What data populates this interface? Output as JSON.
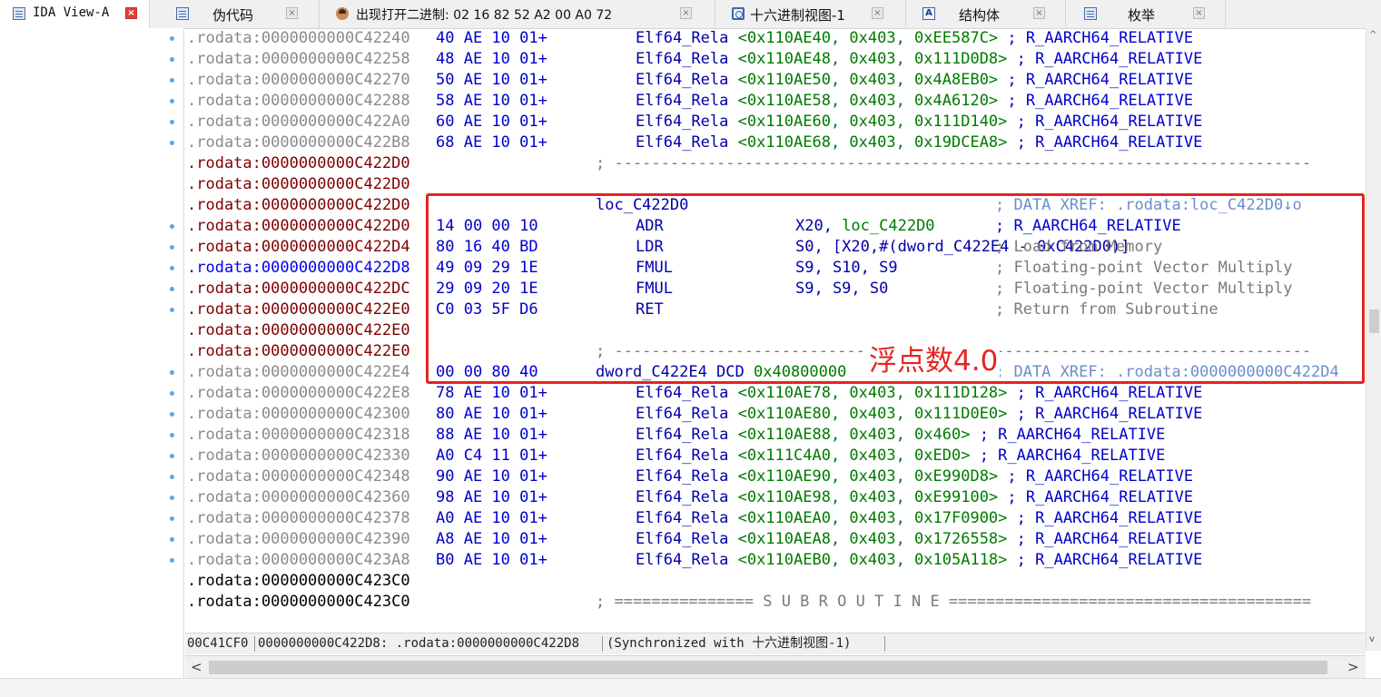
{
  "tabs": [
    {
      "label": "IDA View-A",
      "icon": "doc-icon",
      "active": true
    },
    {
      "label": "伪代码",
      "icon": "doc-icon",
      "active": false
    },
    {
      "label": "出现打开二进制: 02 16 82 52 A2 00 A0 72",
      "icon": "user-icon",
      "active": false
    },
    {
      "label": "十六进制视图-1",
      "icon": "hex-icon",
      "active": false
    },
    {
      "label": "结构体",
      "icon": "struct-icon",
      "active": false
    },
    {
      "label": "枚举",
      "icon": "doc-icon",
      "active": false
    }
  ],
  "close_glyph": "×",
  "listing": [
    {
      "addr": ".rodata:0000000000C42240",
      "addr_color": "gray",
      "bytes": "40 AE 10 01+",
      "code": "Elf64_Rela <0x110AE40, 0x403, 0xEE587C> ; R_AARCH64_RELATIVE",
      "dot": true
    },
    {
      "addr": ".rodata:0000000000C42258",
      "addr_color": "gray",
      "bytes": "48 AE 10 01+",
      "code": "Elf64_Rela <0x110AE48, 0x403, 0x111D0D8> ; R_AARCH64_RELATIVE",
      "dot": true
    },
    {
      "addr": ".rodata:0000000000C42270",
      "addr_color": "gray",
      "bytes": "50 AE 10 01+",
      "code": "Elf64_Rela <0x110AE50, 0x403, 0x4A8EB0> ; R_AARCH64_RELATIVE",
      "dot": true
    },
    {
      "addr": ".rodata:0000000000C42288",
      "addr_color": "gray",
      "bytes": "58 AE 10 01+",
      "code": "Elf64_Rela <0x110AE58, 0x403, 0x4A6120> ; R_AARCH64_RELATIVE",
      "dot": true
    },
    {
      "addr": ".rodata:0000000000C422A0",
      "addr_color": "gray",
      "bytes": "60 AE 10 01+",
      "code": "Elf64_Rela <0x110AE60, 0x403, 0x111D140> ; R_AARCH64_RELATIVE",
      "dot": true
    },
    {
      "addr": ".rodata:0000000000C422B8",
      "addr_color": "gray",
      "bytes": "68 AE 10 01+",
      "code": "Elf64_Rela <0x110AE68, 0x403, 0x19DCEA8> ; R_AARCH64_RELATIVE",
      "dot": true
    },
    {
      "addr": ".rodata:0000000000C422D0",
      "addr_color": "red",
      "bytes": "",
      "code": "; ---------------------------------------------------------------------------",
      "dot": false
    },
    {
      "addr": ".rodata:0000000000C422D0",
      "addr_color": "red",
      "bytes": "",
      "code": "",
      "dot": false
    },
    {
      "addr": ".rodata:0000000000C422D0",
      "addr_color": "red",
      "bytes": "",
      "code": "loc_C422D0",
      "comment": "; DATA XREF: .rodata:loc_C422D0↓o",
      "dot": false
    },
    {
      "addr": ".rodata:0000000000C422D0",
      "addr_color": "red",
      "bytes": "14 00 00 10",
      "mnem": "ADR",
      "ops": "X20, loc_C422D0",
      "comment": "; R_AARCH64_RELATIVE",
      "dot": true
    },
    {
      "addr": ".rodata:0000000000C422D4",
      "addr_color": "red",
      "bytes": "80 16 40 BD",
      "mnem": "LDR",
      "ops": "S0, [X20,#(dword_C422E4 - 0xC422D0)]",
      "comment": "; Load from Memory",
      "dot": true
    },
    {
      "addr": ".rodata:0000000000C422D8",
      "addr_color": "blue",
      "bytes": "49 09 29 1E",
      "mnem": "FMUL",
      "ops": "S9, S10, S9",
      "comment": "; Floating-point Vector Multiply",
      "dot": true
    },
    {
      "addr": ".rodata:0000000000C422DC",
      "addr_color": "red",
      "bytes": "29 09 20 1E",
      "mnem": "FMUL",
      "ops": "S9, S9, S0",
      "comment": "; Floating-point Vector Multiply",
      "dot": true
    },
    {
      "addr": ".rodata:0000000000C422E0",
      "addr_color": "red",
      "bytes": "C0 03 5F D6",
      "mnem": "RET",
      "ops": "",
      "comment": "; Return from Subroutine",
      "dot": true
    },
    {
      "addr": ".rodata:0000000000C422E0",
      "addr_color": "red",
      "bytes": "",
      "code": "",
      "dot": false
    },
    {
      "addr": ".rodata:0000000000C422E0",
      "addr_color": "red",
      "bytes": "",
      "code": "; ---------------------------------------------------------------------------",
      "dot": false
    },
    {
      "addr": ".rodata:0000000000C422E4",
      "addr_color": "gray",
      "bytes": "00 00 80 40",
      "code": "dword_C422E4 DCD 0x40800000",
      "comment": "; DATA XREF: .rodata:0000000000C422D4",
      "dot": true
    },
    {
      "addr": ".rodata:0000000000C422E8",
      "addr_color": "gray",
      "bytes": "78 AE 10 01+",
      "code": "Elf64_Rela <0x110AE78, 0x403, 0x111D128> ; R_AARCH64_RELATIVE",
      "dot": true
    },
    {
      "addr": ".rodata:0000000000C42300",
      "addr_color": "gray",
      "bytes": "80 AE 10 01+",
      "code": "Elf64_Rela <0x110AE80, 0x403, 0x111D0E0> ; R_AARCH64_RELATIVE",
      "dot": true
    },
    {
      "addr": ".rodata:0000000000C42318",
      "addr_color": "gray",
      "bytes": "88 AE 10 01+",
      "code": "Elf64_Rela <0x110AE88, 0x403, 0x460> ; R_AARCH64_RELATIVE",
      "dot": true
    },
    {
      "addr": ".rodata:0000000000C42330",
      "addr_color": "gray",
      "bytes": "A0 C4 11 01+",
      "code": "Elf64_Rela <0x111C4A0, 0x403, 0xED0> ; R_AARCH64_RELATIVE",
      "dot": true
    },
    {
      "addr": ".rodata:0000000000C42348",
      "addr_color": "gray",
      "bytes": "90 AE 10 01+",
      "code": "Elf64_Rela <0x110AE90, 0x403, 0xE990D8> ; R_AARCH64_RELATIVE",
      "dot": true
    },
    {
      "addr": ".rodata:0000000000C42360",
      "addr_color": "gray",
      "bytes": "98 AE 10 01+",
      "code": "Elf64_Rela <0x110AE98, 0x403, 0xE99100> ; R_AARCH64_RELATIVE",
      "dot": true
    },
    {
      "addr": ".rodata:0000000000C42378",
      "addr_color": "gray",
      "bytes": "A0 AE 10 01+",
      "code": "Elf64_Rela <0x110AEA0, 0x403, 0x17F0900> ; R_AARCH64_RELATIVE",
      "dot": true
    },
    {
      "addr": ".rodata:0000000000C42390",
      "addr_color": "gray",
      "bytes": "A8 AE 10 01+",
      "code": "Elf64_Rela <0x110AEA8, 0x403, 0x1726558> ; R_AARCH64_RELATIVE",
      "dot": true
    },
    {
      "addr": ".rodata:0000000000C423A8",
      "addr_color": "gray",
      "bytes": "B0 AE 10 01+",
      "code": "Elf64_Rela <0x110AEB0, 0x403, 0x105A118> ; R_AARCH64_RELATIVE",
      "dot": true
    },
    {
      "addr": ".rodata:0000000000C423C0",
      "addr_color": "black",
      "bytes": "",
      "code": "",
      "dot": false
    },
    {
      "addr": ".rodata:0000000000C423C0",
      "addr_color": "black",
      "bytes": "",
      "code": "; =============== S U B R O U T I N E =======================================",
      "dot": false
    }
  ],
  "annotation": "浮点数4.0",
  "highlight_color": "#e52421",
  "status": {
    "offset": "00C41CF0",
    "location": "0000000000C422D8: .rodata:0000000000C422D8",
    "sync": "(Synchronized with 十六进制视图-1)"
  },
  "scroll": {
    "left": "<",
    "right": ">",
    "up": "^",
    "down": "v"
  }
}
